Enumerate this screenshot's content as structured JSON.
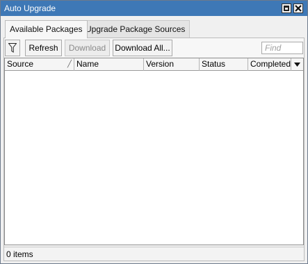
{
  "window": {
    "title": "Auto Upgrade"
  },
  "tabs": [
    {
      "label": "Available Packages",
      "active": true
    },
    {
      "label": "Upgrade Package Sources",
      "active": false
    }
  ],
  "toolbar": {
    "filter_icon": "filter-icon",
    "refresh_label": "Refresh",
    "download_label": "Download",
    "download_enabled": false,
    "download_all_label": "Download All...",
    "find_placeholder": "Find"
  },
  "table": {
    "columns": [
      "Source",
      "Name",
      "Version",
      "Status",
      "Completed"
    ],
    "sorted_column": "Source",
    "rows": []
  },
  "status": {
    "items_text": "0 items"
  },
  "colors": {
    "titlebar": "#3e78b6",
    "panel": "#f7f7f7"
  }
}
